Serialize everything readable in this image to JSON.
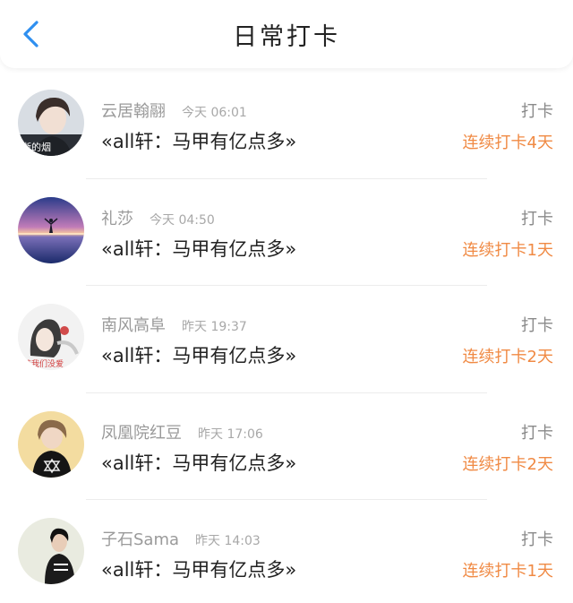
{
  "header": {
    "title": "日常打卡"
  },
  "items": [
    {
      "name": "云居翰翮",
      "time": "今天 06:01",
      "content": "«all轩：马甲有亿点多»",
      "action": "打卡",
      "streak": "连续打卡4天",
      "avatar_text": "逝的烟"
    },
    {
      "name": "礼莎",
      "time": "今天 04:50",
      "content": "«all轩：马甲有亿点多»",
      "action": "打卡",
      "streak": "连续打卡1天"
    },
    {
      "name": "南风高阜",
      "time": "昨天 19:37",
      "content": "«all轩：马甲有亿点多»",
      "action": "打卡",
      "streak": "连续打卡2天",
      "avatar_text": "装我们没爱"
    },
    {
      "name": "凤凰院红豆",
      "time": "昨天 17:06",
      "content": "«all轩：马甲有亿点多»",
      "action": "打卡",
      "streak": "连续打卡2天"
    },
    {
      "name": "子石Sama",
      "time": "昨天 14:03",
      "content": "«all轩：马甲有亿点多»",
      "action": "打卡",
      "streak": "连续打卡1天"
    }
  ],
  "colors": {
    "accent": "#2f8ff0",
    "streak": "#f08a44",
    "muted": "#9a9a9a"
  },
  "icons": {
    "back": "chevron-left-icon"
  }
}
